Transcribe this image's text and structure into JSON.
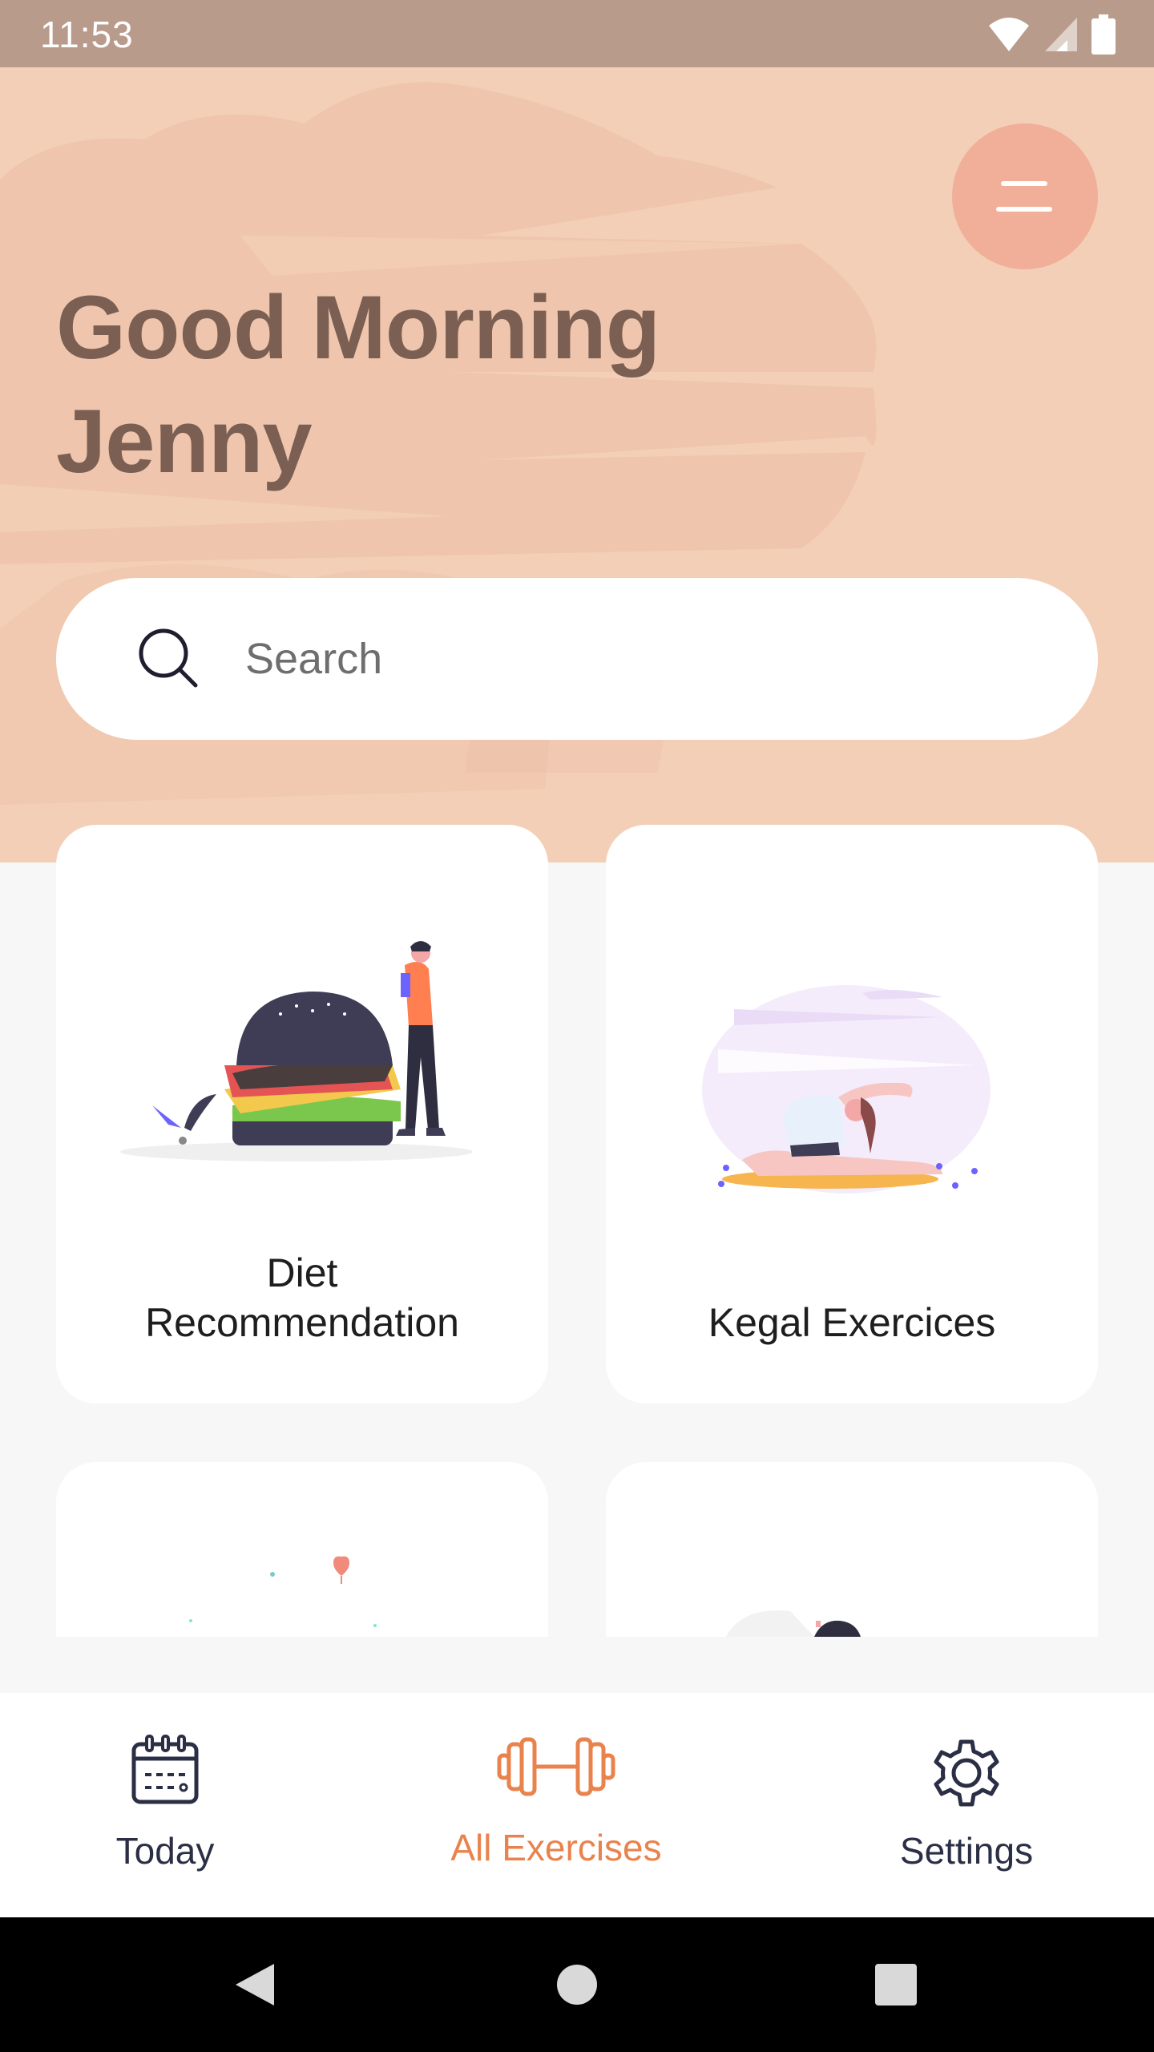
{
  "status_bar": {
    "time": "11:53",
    "icons": [
      "wifi-icon",
      "signal-icon",
      "battery-icon"
    ]
  },
  "header": {
    "greeting_line1": "Good Morning",
    "greeting_line2": "Jenny",
    "menu_icon": "menu-icon"
  },
  "search": {
    "placeholder": "Search",
    "value": "",
    "icon": "search-icon"
  },
  "cards": [
    {
      "title_line1": "Diet",
      "title_line2": "Recommendation",
      "illustration": "burger-illustration"
    },
    {
      "title": "Kegal Exercices",
      "illustration": "yoga-illustration"
    },
    {
      "title": "",
      "illustration": "partial-illustration"
    },
    {
      "title": "",
      "illustration": "partial-illustration"
    }
  ],
  "bottom_nav": {
    "items": [
      {
        "label": "Today",
        "icon": "calendar-icon",
        "active": false
      },
      {
        "label": "All Exercises",
        "icon": "dumbbell-icon",
        "active": true
      },
      {
        "label": "Settings",
        "icon": "gear-icon",
        "active": false
      }
    ]
  },
  "system_nav": {
    "buttons": [
      "back-icon",
      "home-icon",
      "recents-icon"
    ]
  },
  "colors": {
    "status_bar": "#B99B8C",
    "hero_bg": "#F3CFB7",
    "greeting_text": "#7A5F52",
    "menu_button": "#F1AE99",
    "active_nav": "#E9834D",
    "inactive_nav": "#2B2F45",
    "page_bg": "#F7F7F7"
  }
}
